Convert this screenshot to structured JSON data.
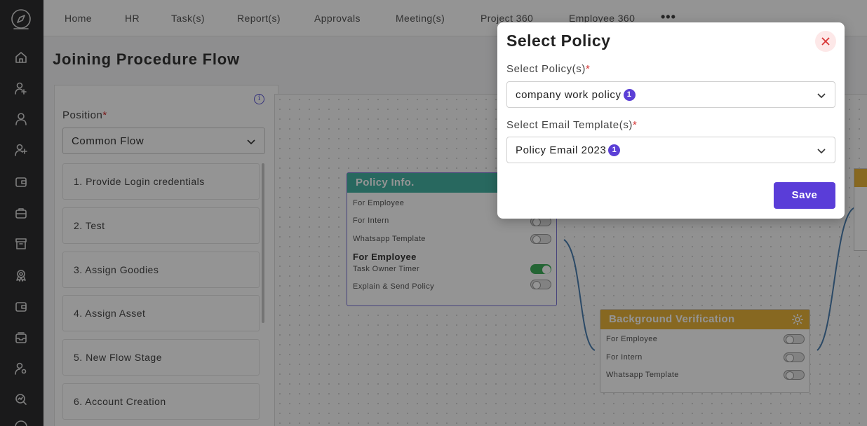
{
  "nav": {
    "items": [
      "Home",
      "HR",
      "Task(s)",
      "Report(s)",
      "Approvals",
      "Meeting(s)",
      "Project 360",
      "Employee 360"
    ],
    "more_label": "•••"
  },
  "page": {
    "title": "Joining Procedure Flow"
  },
  "panel": {
    "position_label": "Position",
    "required_mark": "*",
    "position_value": "Common Flow",
    "info_glyph": "i",
    "steps": [
      "1. Provide Login credentials",
      "2. Test",
      "3. Assign Goodies",
      "4. Assign Asset",
      "5. New Flow Stage",
      "6. Account Creation"
    ]
  },
  "flow": {
    "policy_node": {
      "title": "Policy Info.",
      "rows": [
        "For Employee",
        "For Intern",
        "Whatsapp Template"
      ],
      "sub_heading": "For Employee",
      "sub_rows": [
        "Task Owner Timer",
        "Explain & Send Policy"
      ],
      "toggles": [
        false,
        false,
        false,
        true,
        false
      ]
    },
    "bg_node": {
      "title": "Background Verification",
      "rows": [
        "For Employee",
        "For Intern",
        "Whatsapp Template"
      ],
      "toggles": [
        false,
        false,
        false
      ]
    }
  },
  "modal": {
    "title": "Select Policy",
    "policy_label": "Select Policy(s)",
    "policy_value": "company work policy",
    "policy_count": "1",
    "template_label": "Select Email Template(s)",
    "template_value": "Policy Email 2023",
    "template_count": "1",
    "save_label": "Save"
  },
  "colors": {
    "accent": "#5a3dd8",
    "policy_header": "#46b3a4",
    "bg_header": "#e8b43a",
    "sidebar": "#2d2d2f",
    "toggle_on": "#3fae5a"
  },
  "icons": [
    "compass-icon",
    "home-icon",
    "user-add-icon",
    "user-icon",
    "user-plus-icon",
    "wallet-icon",
    "briefcase-icon",
    "archive-icon",
    "award-icon",
    "wallet-icon",
    "inbox-icon",
    "user-settings-icon",
    "search-chart-icon",
    "help-icon"
  ]
}
